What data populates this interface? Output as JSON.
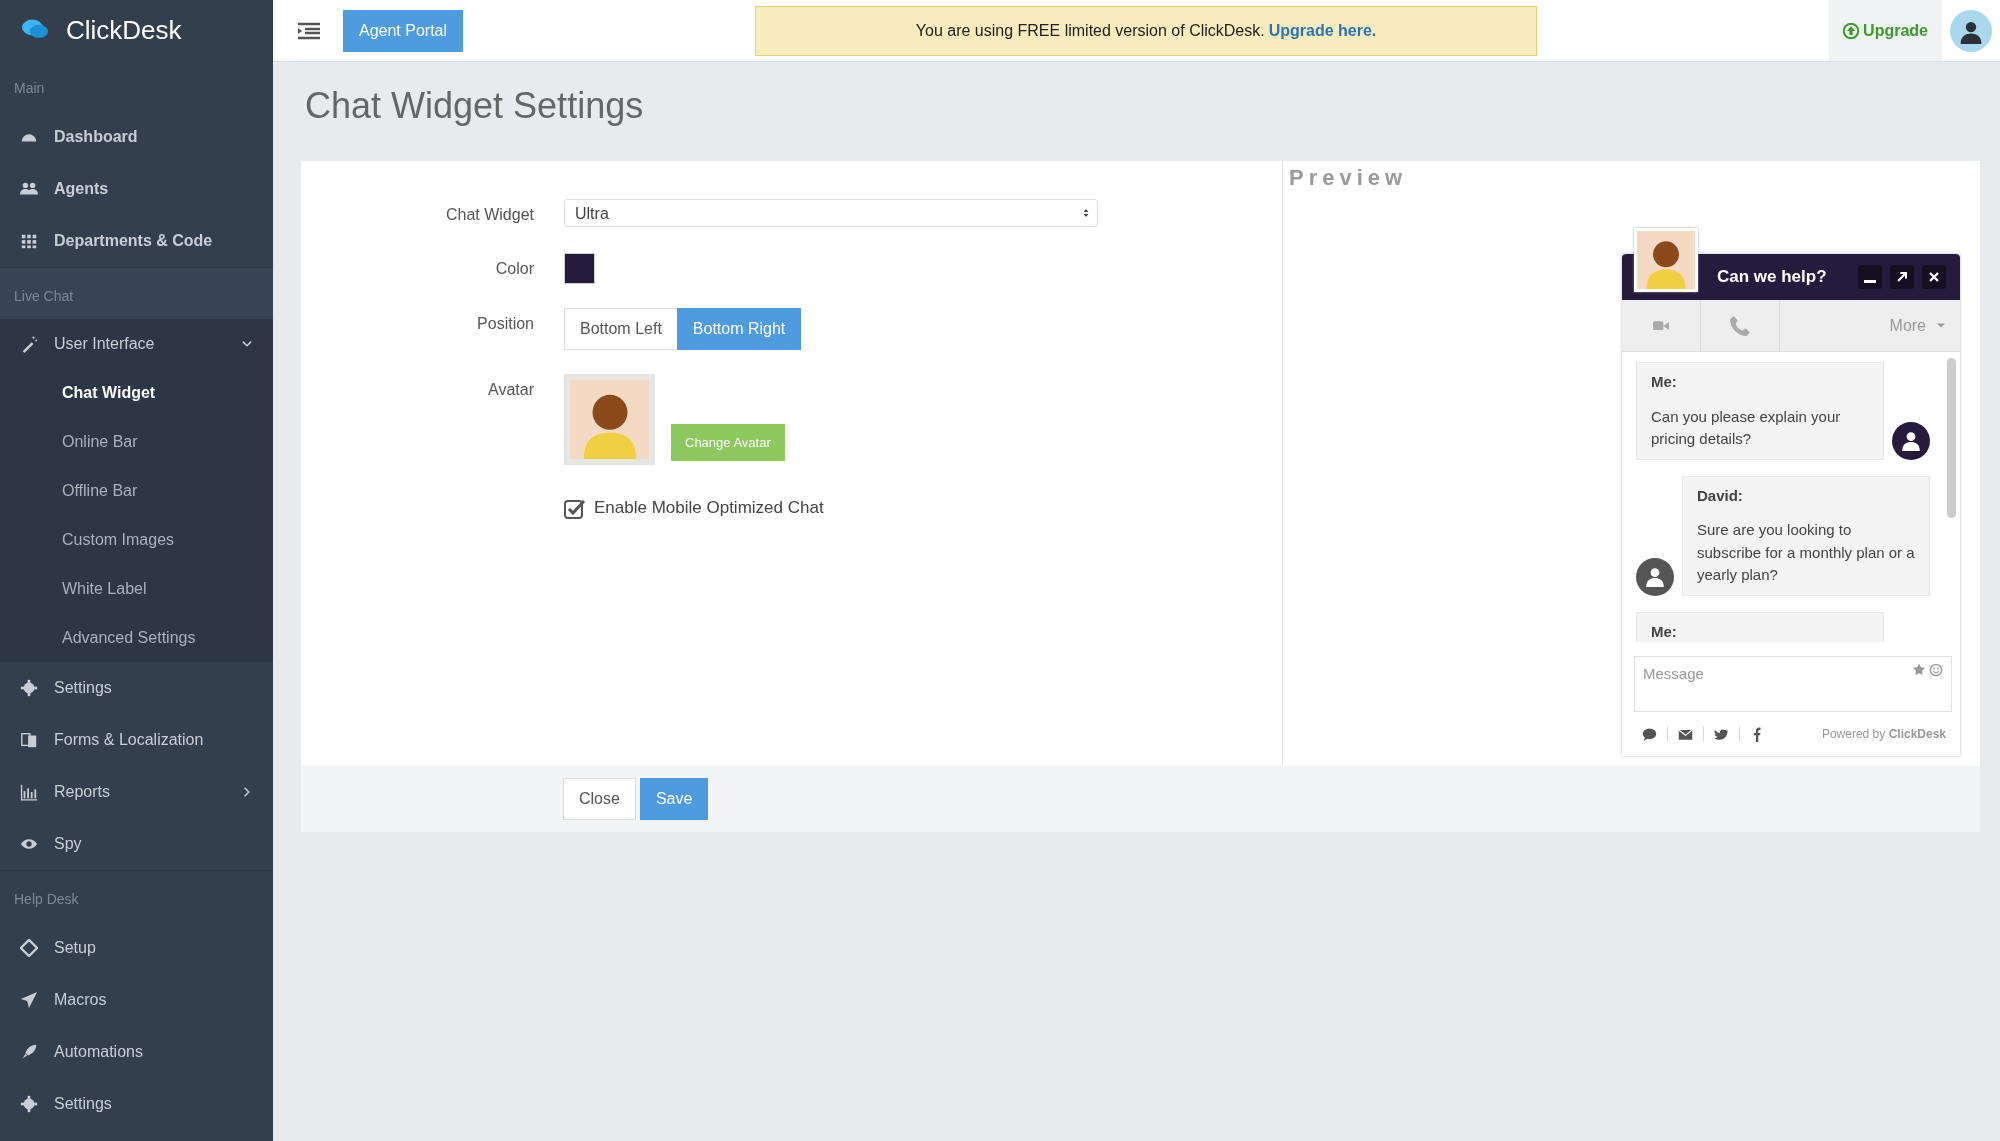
{
  "sidebar": {
    "logo": "ClickDesk",
    "sections": [
      {
        "heading": "Main",
        "items": [
          {
            "label": "Dashboard",
            "bold": true
          },
          {
            "label": "Agents",
            "bold": true
          },
          {
            "label": "Departments & Code",
            "bold": true
          }
        ]
      },
      {
        "heading": "Live Chat",
        "items": [
          {
            "label": "User Interface",
            "expanded": true,
            "children": [
              {
                "label": "Chat Widget",
                "selected": true
              },
              {
                "label": "Online Bar",
                "selected": false
              },
              {
                "label": "Offline Bar",
                "selected": false
              },
              {
                "label": "Custom Images",
                "selected": false
              },
              {
                "label": "White Label",
                "selected": false
              },
              {
                "label": "Advanced Settings",
                "selected": false
              }
            ]
          },
          {
            "label": "Settings"
          },
          {
            "label": "Forms & Localization"
          },
          {
            "label": "Reports",
            "expanded": false
          },
          {
            "label": "Spy"
          }
        ]
      },
      {
        "heading": "Help Desk",
        "items": [
          {
            "label": "Setup"
          },
          {
            "label": "Macros"
          },
          {
            "label": "Automations"
          },
          {
            "label": "Settings"
          }
        ]
      }
    ]
  },
  "header": {
    "agent_portal": "Agent Portal",
    "notice": {
      "text": "You are using FREE limited version of ClickDesk.",
      "link": "Upgrade here."
    },
    "upgrade": "Upgrade"
  },
  "page_title": "Chat Widget Settings",
  "form": {
    "chat_widget": {
      "label": "Chat Widget",
      "value": "Ultra"
    },
    "color": {
      "label": "Color",
      "color": "#241b3d"
    },
    "position": {
      "label": "Position",
      "options": [
        {
          "label": "Bottom Left",
          "selected": false
        },
        {
          "label": "Bottom Right",
          "selected": true
        }
      ]
    },
    "avatar": {
      "label": "Avatar",
      "button": "Change Avatar"
    },
    "mobile": {
      "label": "Enable Mobile Optimized Chat",
      "checked": true
    }
  },
  "footer_buttons": [
    "Close",
    "Save"
  ],
  "preview": {
    "title": "Preview",
    "widget": {
      "header": "Can we help?",
      "more": "More",
      "messages": [
        {
          "kind": "outgoing",
          "author": "Me:",
          "text": "Can you please explain your pricing details?"
        },
        {
          "kind": "incoming",
          "author": "David:",
          "text": "Sure are you looking to subscribe for a monthly plan or a yearly plan?"
        },
        {
          "kind": "outgoing",
          "author": "Me:"
        }
      ],
      "placeholder": "Message",
      "powered": "Powered by **ClickDesk**"
    }
  }
}
